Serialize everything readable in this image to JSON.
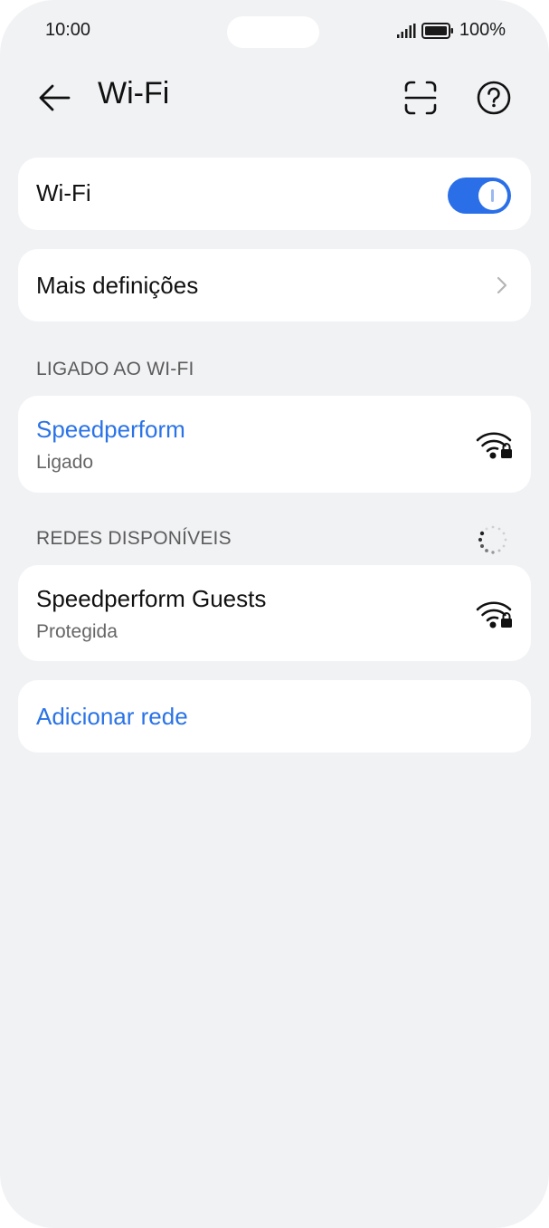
{
  "status_bar": {
    "time": "10:00",
    "battery": "100%"
  },
  "header": {
    "title": "Wi-Fi"
  },
  "wifi_toggle": {
    "label": "Wi-Fi",
    "state": "on"
  },
  "more_settings": {
    "label": "Mais definições"
  },
  "connected_section": {
    "label": "LIGADO AO WI-FI",
    "network": {
      "name": "Speedperform",
      "status": "Ligado"
    }
  },
  "available_section": {
    "label": "REDES DISPONÍVEIS",
    "networks": [
      {
        "name": "Speedperform Guests",
        "status": "Protegida"
      }
    ]
  },
  "add_network": {
    "label": "Adicionar rede"
  },
  "colors": {
    "accent": "#2a73e6",
    "background": "#f1f2f4",
    "card": "#ffffff"
  }
}
